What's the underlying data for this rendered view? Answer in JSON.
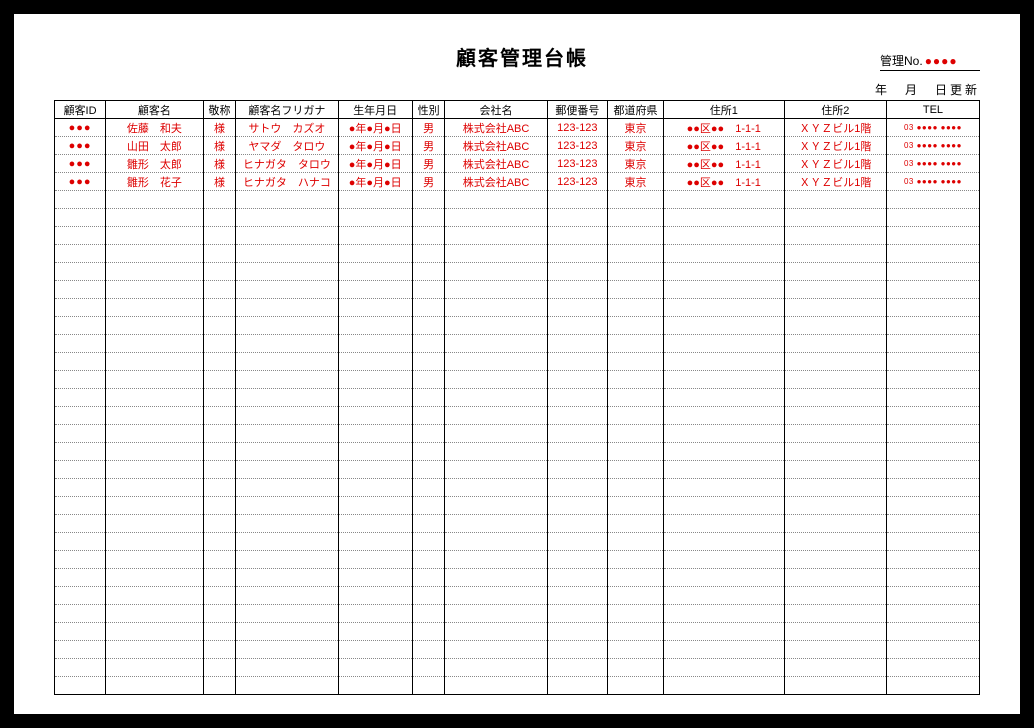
{
  "header": {
    "title": "顧客管理台帳",
    "mgmt_no_label": "管理No.",
    "mgmt_no_value": "●●●●",
    "update_label": "年　月　日更新"
  },
  "columns": [
    "顧客ID",
    "顧客名",
    "敬称",
    "顧客名フリガナ",
    "生年月日",
    "性別",
    "会社名",
    "郵便番号",
    "都道府県",
    "住所1",
    "住所2",
    "TEL"
  ],
  "rows": [
    {
      "id": "●●●",
      "name": "佐藤　和夫",
      "hon": "様",
      "furigana": "サトウ　カズオ",
      "dob": "●年●月●日",
      "sex": "男",
      "company": "株式会社ABC",
      "zip": "123-123",
      "pref": "東京",
      "addr1": "●●区●●　1-1-1",
      "addr2": "ＸＹＺビル1階",
      "tel": "03 ●●●● ●●●●"
    },
    {
      "id": "●●●",
      "name": "山田　太郎",
      "hon": "様",
      "furigana": "ヤマダ　タロウ",
      "dob": "●年●月●日",
      "sex": "男",
      "company": "株式会社ABC",
      "zip": "123-123",
      "pref": "東京",
      "addr1": "●●区●●　1-1-1",
      "addr2": "ＸＹＺビル1階",
      "tel": "03 ●●●● ●●●●"
    },
    {
      "id": "●●●",
      "name": "雛形　太郎",
      "hon": "様",
      "furigana": "ヒナガタ　タロウ",
      "dob": "●年●月●日",
      "sex": "男",
      "company": "株式会社ABC",
      "zip": "123-123",
      "pref": "東京",
      "addr1": "●●区●●　1-1-1",
      "addr2": "ＸＹＺビル1階",
      "tel": "03 ●●●● ●●●●"
    },
    {
      "id": "●●●",
      "name": "雛形　花子",
      "hon": "様",
      "furigana": "ヒナガタ　ハナコ",
      "dob": "●年●月●日",
      "sex": "男",
      "company": "株式会社ABC",
      "zip": "123-123",
      "pref": "東京",
      "addr1": "●●区●●　1-1-1",
      "addr2": "ＸＹＺビル1階",
      "tel": "03 ●●●● ●●●●"
    }
  ],
  "empty_row_count": 28
}
